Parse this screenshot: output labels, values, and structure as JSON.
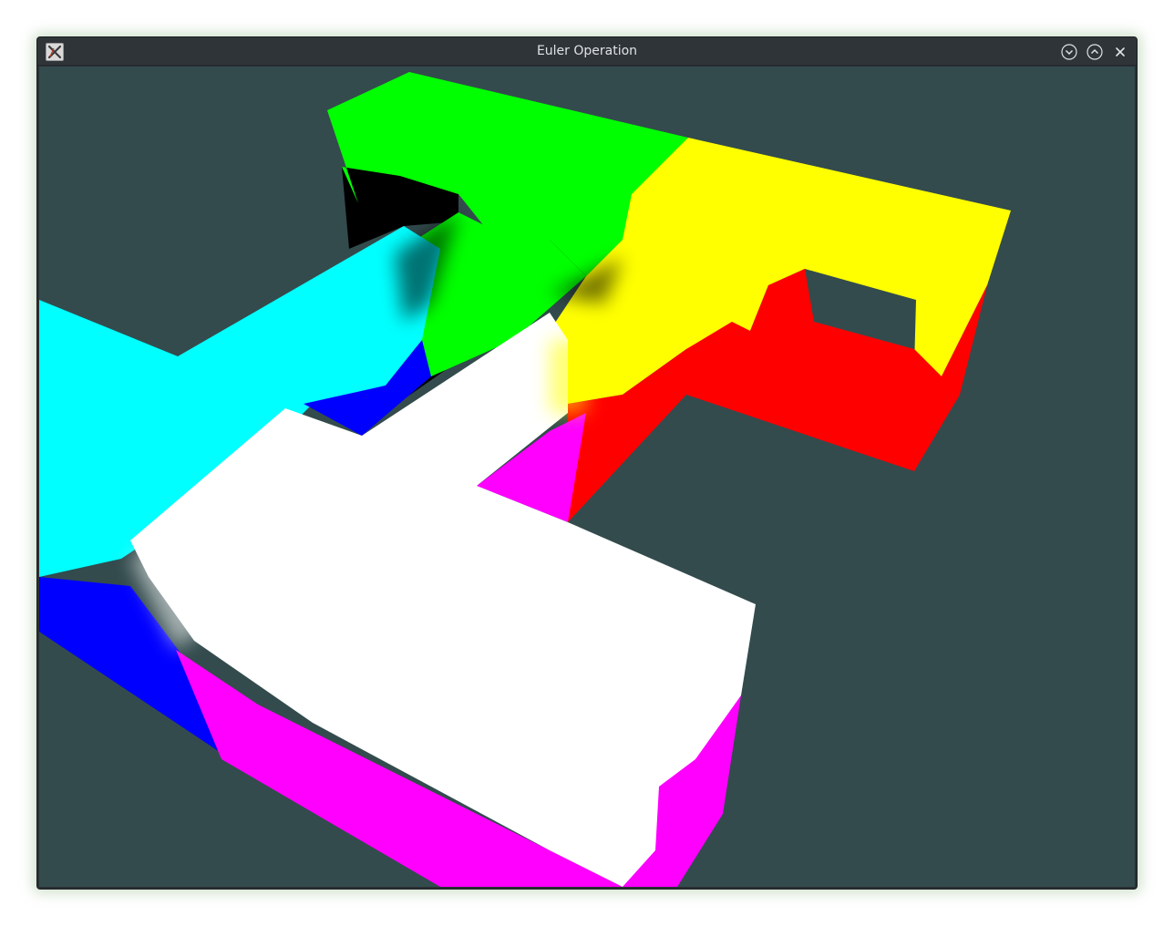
{
  "window": {
    "title": "Euler Operation"
  },
  "icons": {
    "app": "x-window-icon",
    "minimize": "chevron-down-icon",
    "maximize": "chevron-up-icon",
    "close": "close-icon"
  },
  "colors": {
    "background": "#334b4d",
    "cyan": "#00ffff",
    "green": "#00ff00",
    "yellow": "#ffff00",
    "red": "#ff0000",
    "white": "#ffffff",
    "magenta": "#ff00ff",
    "blue": "#0000ff",
    "black": "#000000"
  }
}
